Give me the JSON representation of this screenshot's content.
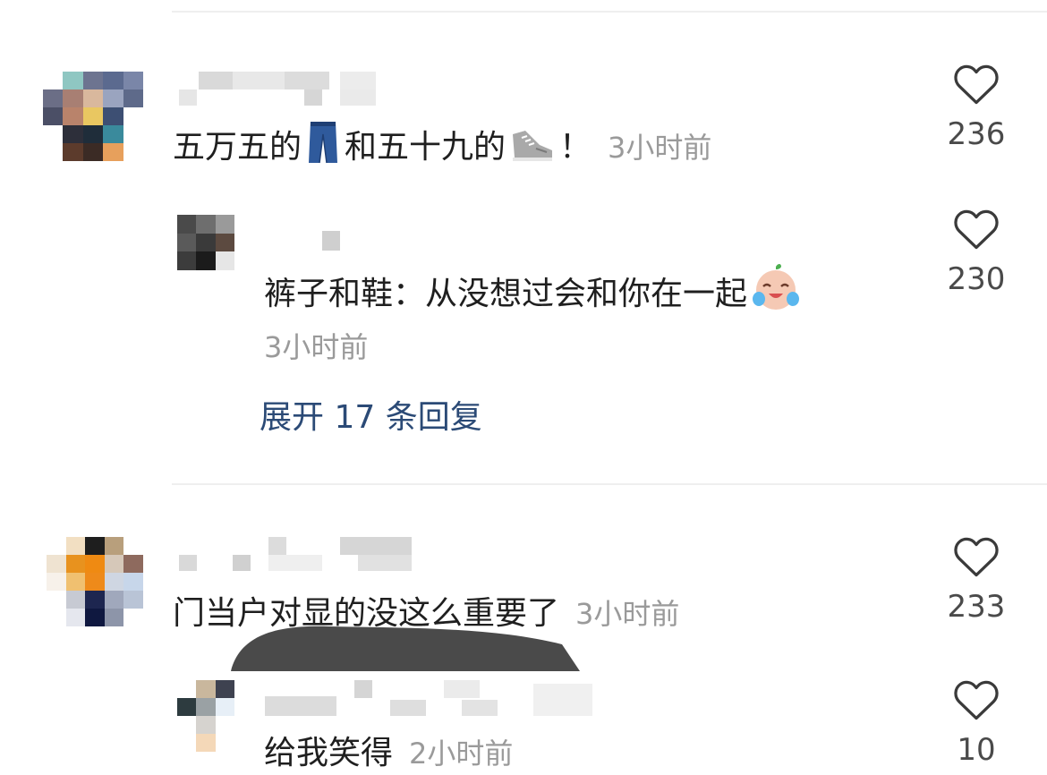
{
  "comments": [
    {
      "text": "五万五的",
      "text_after_emoji1": "和五十九的",
      "text_end": "！",
      "emoji1": "jeans-emoji",
      "emoji2": "sneaker-emoji",
      "time": "3小时前",
      "likes": "236",
      "reply": {
        "text": "裤子和鞋：从没想过会和你在一起",
        "emoji": "crying-laughing-emoji",
        "time": "3小时前",
        "likes": "230"
      },
      "expand_label": "展开 17 条回复"
    },
    {
      "text": "门当户对显的没这么重要了",
      "time": "3小时前",
      "likes": "233",
      "reply": {
        "text": "给我笑得",
        "time": "2小时前",
        "likes": "10"
      }
    }
  ],
  "colors": {
    "link": "#2b4a76",
    "time": "#9a9a9a",
    "text": "#1f1f1f"
  }
}
